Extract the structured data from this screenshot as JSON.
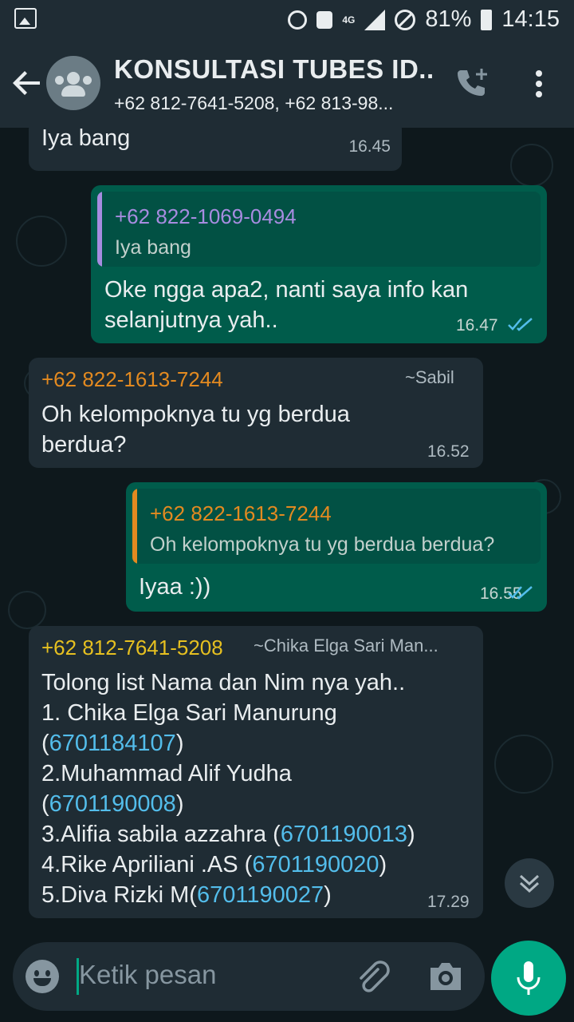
{
  "status_bar": {
    "network": "4G",
    "battery": "81%",
    "time": "14:15",
    "icons": [
      "image-icon",
      "alarm-icon",
      "heart-icon",
      "signal-icon",
      "block-icon",
      "battery-icon"
    ]
  },
  "header": {
    "back_icon": "arrow-left-icon",
    "title": "KONSULTASI TUBES ID...",
    "subtitle": "+62 812-7641-5208, +62 813-98...",
    "actions": [
      "add-call-icon",
      "more-vert-icon"
    ]
  },
  "messages": [
    {
      "direction": "in",
      "text": "Iya bang",
      "time": "16.45"
    },
    {
      "direction": "out",
      "quote": {
        "name": "+62 822-1069-0494",
        "text": "Iya bang",
        "color": "#a78ce0"
      },
      "text_lines": [
        "Oke ngga apa2, nanti saya info kan",
        "selanjutnya  yah.."
      ],
      "time": "16.47",
      "read": true
    },
    {
      "direction": "in",
      "sender": "+62 822-1613-7244",
      "pushname": "~Sabil",
      "sender_color": "#e38a20",
      "text_lines": [
        "Oh kelompoknya tu yg berdua",
        "berdua?"
      ],
      "time": "16.52"
    },
    {
      "direction": "out",
      "quote": {
        "name": "+62 822-1613-7244",
        "text": "Oh kelompoknya tu yg berdua berdua?",
        "color": "#e38a20"
      },
      "text": "Iyaa :))",
      "time": "16.55",
      "read": true
    },
    {
      "direction": "in",
      "sender": "+62 812-7641-5208",
      "pushname": "~Chika Elga Sari Man...",
      "sender_color": "#e6c020",
      "lines": [
        {
          "pre": "Tolong list Nama dan Nim nya yah..",
          "link": "",
          "post": ""
        },
        {
          "pre": "1. Chika Elga Sari Manurung",
          "link": "",
          "post": ""
        },
        {
          "pre": "(",
          "link": "6701184107",
          "post": ")"
        },
        {
          "pre": "2.Muhammad Alif Yudha",
          "link": "",
          "post": ""
        },
        {
          "pre": "(",
          "link": "6701190008",
          "post": ")"
        },
        {
          "pre": "3.Alifia sabila azzahra (",
          "link": "6701190013",
          "post": ")"
        },
        {
          "pre": "4.Rike Apriliani .AS  (",
          "link": "6701190020",
          "post": ")"
        },
        {
          "pre": "5.Diva Rizki M(",
          "link": "6701190027",
          "post": ")"
        }
      ],
      "time": "17.29"
    }
  ],
  "composer": {
    "placeholder": "Ketik pesan",
    "icons": [
      "emoji-icon",
      "attach-icon",
      "camera-icon",
      "mic-icon"
    ]
  },
  "colors": {
    "accent": "#00a884",
    "outgoing": "#005c4b",
    "incoming": "#1f2c34",
    "link": "#53bdeb",
    "read_ticks": "#53bdeb"
  }
}
